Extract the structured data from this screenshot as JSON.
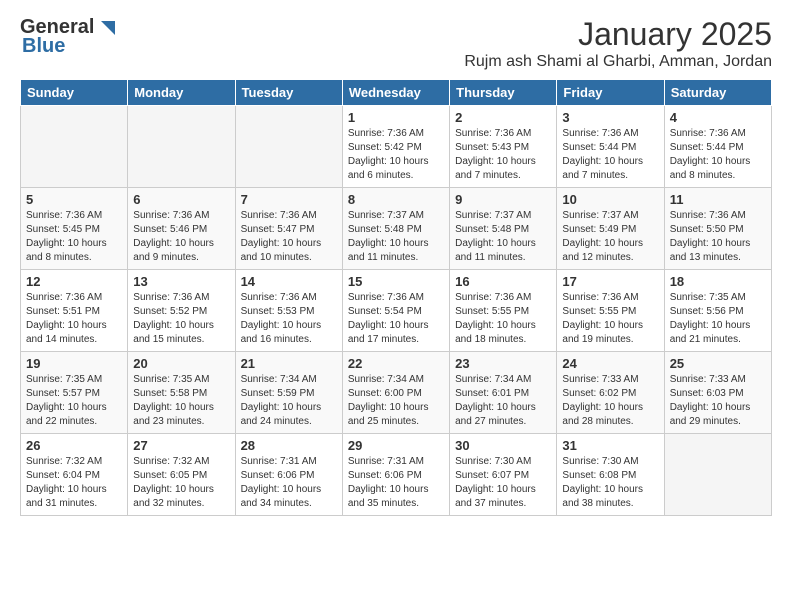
{
  "header": {
    "logo_general": "General",
    "logo_blue": "Blue",
    "month_title": "January 2025",
    "location": "Rujm ash Shami al Gharbi, Amman, Jordan"
  },
  "days_of_week": [
    "Sunday",
    "Monday",
    "Tuesday",
    "Wednesday",
    "Thursday",
    "Friday",
    "Saturday"
  ],
  "weeks": [
    [
      {
        "day": "",
        "info": ""
      },
      {
        "day": "",
        "info": ""
      },
      {
        "day": "",
        "info": ""
      },
      {
        "day": "1",
        "info": "Sunrise: 7:36 AM\nSunset: 5:42 PM\nDaylight: 10 hours\nand 6 minutes."
      },
      {
        "day": "2",
        "info": "Sunrise: 7:36 AM\nSunset: 5:43 PM\nDaylight: 10 hours\nand 7 minutes."
      },
      {
        "day": "3",
        "info": "Sunrise: 7:36 AM\nSunset: 5:44 PM\nDaylight: 10 hours\nand 7 minutes."
      },
      {
        "day": "4",
        "info": "Sunrise: 7:36 AM\nSunset: 5:44 PM\nDaylight: 10 hours\nand 8 minutes."
      }
    ],
    [
      {
        "day": "5",
        "info": "Sunrise: 7:36 AM\nSunset: 5:45 PM\nDaylight: 10 hours\nand 8 minutes."
      },
      {
        "day": "6",
        "info": "Sunrise: 7:36 AM\nSunset: 5:46 PM\nDaylight: 10 hours\nand 9 minutes."
      },
      {
        "day": "7",
        "info": "Sunrise: 7:36 AM\nSunset: 5:47 PM\nDaylight: 10 hours\nand 10 minutes."
      },
      {
        "day": "8",
        "info": "Sunrise: 7:37 AM\nSunset: 5:48 PM\nDaylight: 10 hours\nand 11 minutes."
      },
      {
        "day": "9",
        "info": "Sunrise: 7:37 AM\nSunset: 5:48 PM\nDaylight: 10 hours\nand 11 minutes."
      },
      {
        "day": "10",
        "info": "Sunrise: 7:37 AM\nSunset: 5:49 PM\nDaylight: 10 hours\nand 12 minutes."
      },
      {
        "day": "11",
        "info": "Sunrise: 7:36 AM\nSunset: 5:50 PM\nDaylight: 10 hours\nand 13 minutes."
      }
    ],
    [
      {
        "day": "12",
        "info": "Sunrise: 7:36 AM\nSunset: 5:51 PM\nDaylight: 10 hours\nand 14 minutes."
      },
      {
        "day": "13",
        "info": "Sunrise: 7:36 AM\nSunset: 5:52 PM\nDaylight: 10 hours\nand 15 minutes."
      },
      {
        "day": "14",
        "info": "Sunrise: 7:36 AM\nSunset: 5:53 PM\nDaylight: 10 hours\nand 16 minutes."
      },
      {
        "day": "15",
        "info": "Sunrise: 7:36 AM\nSunset: 5:54 PM\nDaylight: 10 hours\nand 17 minutes."
      },
      {
        "day": "16",
        "info": "Sunrise: 7:36 AM\nSunset: 5:55 PM\nDaylight: 10 hours\nand 18 minutes."
      },
      {
        "day": "17",
        "info": "Sunrise: 7:36 AM\nSunset: 5:55 PM\nDaylight: 10 hours\nand 19 minutes."
      },
      {
        "day": "18",
        "info": "Sunrise: 7:35 AM\nSunset: 5:56 PM\nDaylight: 10 hours\nand 21 minutes."
      }
    ],
    [
      {
        "day": "19",
        "info": "Sunrise: 7:35 AM\nSunset: 5:57 PM\nDaylight: 10 hours\nand 22 minutes."
      },
      {
        "day": "20",
        "info": "Sunrise: 7:35 AM\nSunset: 5:58 PM\nDaylight: 10 hours\nand 23 minutes."
      },
      {
        "day": "21",
        "info": "Sunrise: 7:34 AM\nSunset: 5:59 PM\nDaylight: 10 hours\nand 24 minutes."
      },
      {
        "day": "22",
        "info": "Sunrise: 7:34 AM\nSunset: 6:00 PM\nDaylight: 10 hours\nand 25 minutes."
      },
      {
        "day": "23",
        "info": "Sunrise: 7:34 AM\nSunset: 6:01 PM\nDaylight: 10 hours\nand 27 minutes."
      },
      {
        "day": "24",
        "info": "Sunrise: 7:33 AM\nSunset: 6:02 PM\nDaylight: 10 hours\nand 28 minutes."
      },
      {
        "day": "25",
        "info": "Sunrise: 7:33 AM\nSunset: 6:03 PM\nDaylight: 10 hours\nand 29 minutes."
      }
    ],
    [
      {
        "day": "26",
        "info": "Sunrise: 7:32 AM\nSunset: 6:04 PM\nDaylight: 10 hours\nand 31 minutes."
      },
      {
        "day": "27",
        "info": "Sunrise: 7:32 AM\nSunset: 6:05 PM\nDaylight: 10 hours\nand 32 minutes."
      },
      {
        "day": "28",
        "info": "Sunrise: 7:31 AM\nSunset: 6:06 PM\nDaylight: 10 hours\nand 34 minutes."
      },
      {
        "day": "29",
        "info": "Sunrise: 7:31 AM\nSunset: 6:06 PM\nDaylight: 10 hours\nand 35 minutes."
      },
      {
        "day": "30",
        "info": "Sunrise: 7:30 AM\nSunset: 6:07 PM\nDaylight: 10 hours\nand 37 minutes."
      },
      {
        "day": "31",
        "info": "Sunrise: 7:30 AM\nSunset: 6:08 PM\nDaylight: 10 hours\nand 38 minutes."
      },
      {
        "day": "",
        "info": ""
      }
    ]
  ]
}
